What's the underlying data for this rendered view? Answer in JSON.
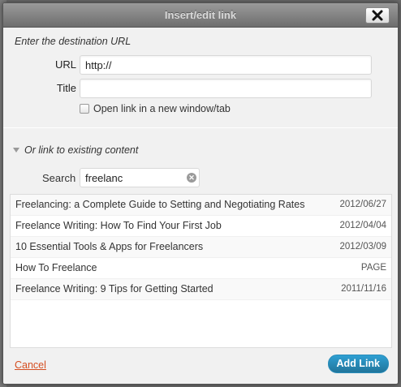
{
  "dialog": {
    "title": "Insert/edit link"
  },
  "url_section": {
    "heading": "Enter the destination URL",
    "url_label": "URL",
    "url_value": "http://",
    "title_label": "Title",
    "title_value": "",
    "new_window_label": "Open link in a new window/tab",
    "new_window_checked": false
  },
  "existing_section": {
    "toggle_label": "Or link to existing content",
    "search_label": "Search",
    "search_value": "freelanc"
  },
  "results": [
    {
      "title": "Freelancing: a Complete Guide to Setting and Negotiating Rates",
      "meta": "2012/06/27"
    },
    {
      "title": "Freelance Writing: How To Find Your First Job",
      "meta": "2012/04/04"
    },
    {
      "title": "10 Essential Tools & Apps for Freelancers",
      "meta": "2012/03/09"
    },
    {
      "title": "How To Freelance",
      "meta": "PAGE"
    },
    {
      "title": "Freelance Writing: 9 Tips for Getting Started",
      "meta": "2011/11/16"
    }
  ],
  "footer": {
    "cancel_label": "Cancel",
    "submit_label": "Add Link"
  },
  "colors": {
    "accent": "#21759b",
    "cancel": "#d54e21"
  }
}
